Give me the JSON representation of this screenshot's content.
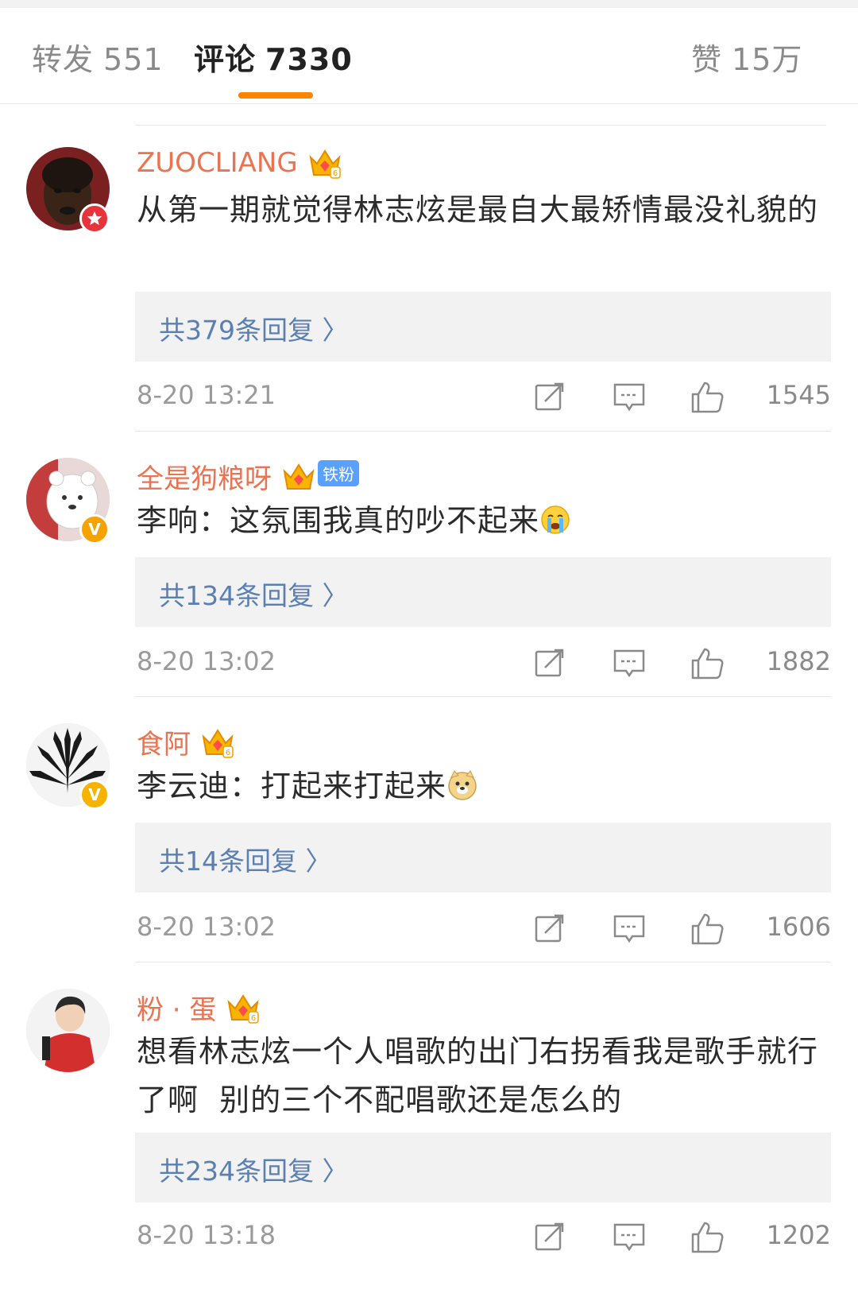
{
  "tabs": {
    "repost": {
      "label": "转发",
      "count": "551"
    },
    "comment": {
      "label": "评论",
      "count": "7330"
    },
    "like": {
      "label": "赞",
      "count": "15万"
    }
  },
  "colors": {
    "accent": "#ff8200",
    "username": "#eb7350",
    "reply_link": "#5a7fb2"
  },
  "comments": [
    {
      "username": "ZUOCLIANG",
      "badge": "star",
      "text": "从第一期就觉得林志炫是最自大最矫情最没礼貌的",
      "replies": "共379条回复 〉",
      "time": "8-20 13:21",
      "likes": "1545"
    },
    {
      "username": "全是狗粮呀",
      "badge": "V",
      "fan_tag": "铁粉",
      "text": "李响：这氛围我真的吵不起来",
      "emoji": "crying-emoji",
      "replies": "共134条回复 〉",
      "time": "8-20 13:02",
      "likes": "1882"
    },
    {
      "username": "食阿",
      "badge": "V",
      "text": "李云迪：打起来打起来",
      "emoji": "doge-emoji",
      "replies": "共14条回复 〉",
      "time": "8-20 13:02",
      "likes": "1606"
    },
    {
      "username": "粉 · 蛋",
      "text": "想看林志炫一个人唱歌的出门右拐看我是歌手就行了啊  别的三个不配唱歌还是怎么的",
      "replies": "共234条回复 〉",
      "time": "8-20 13:18",
      "likes": "1202"
    }
  ]
}
